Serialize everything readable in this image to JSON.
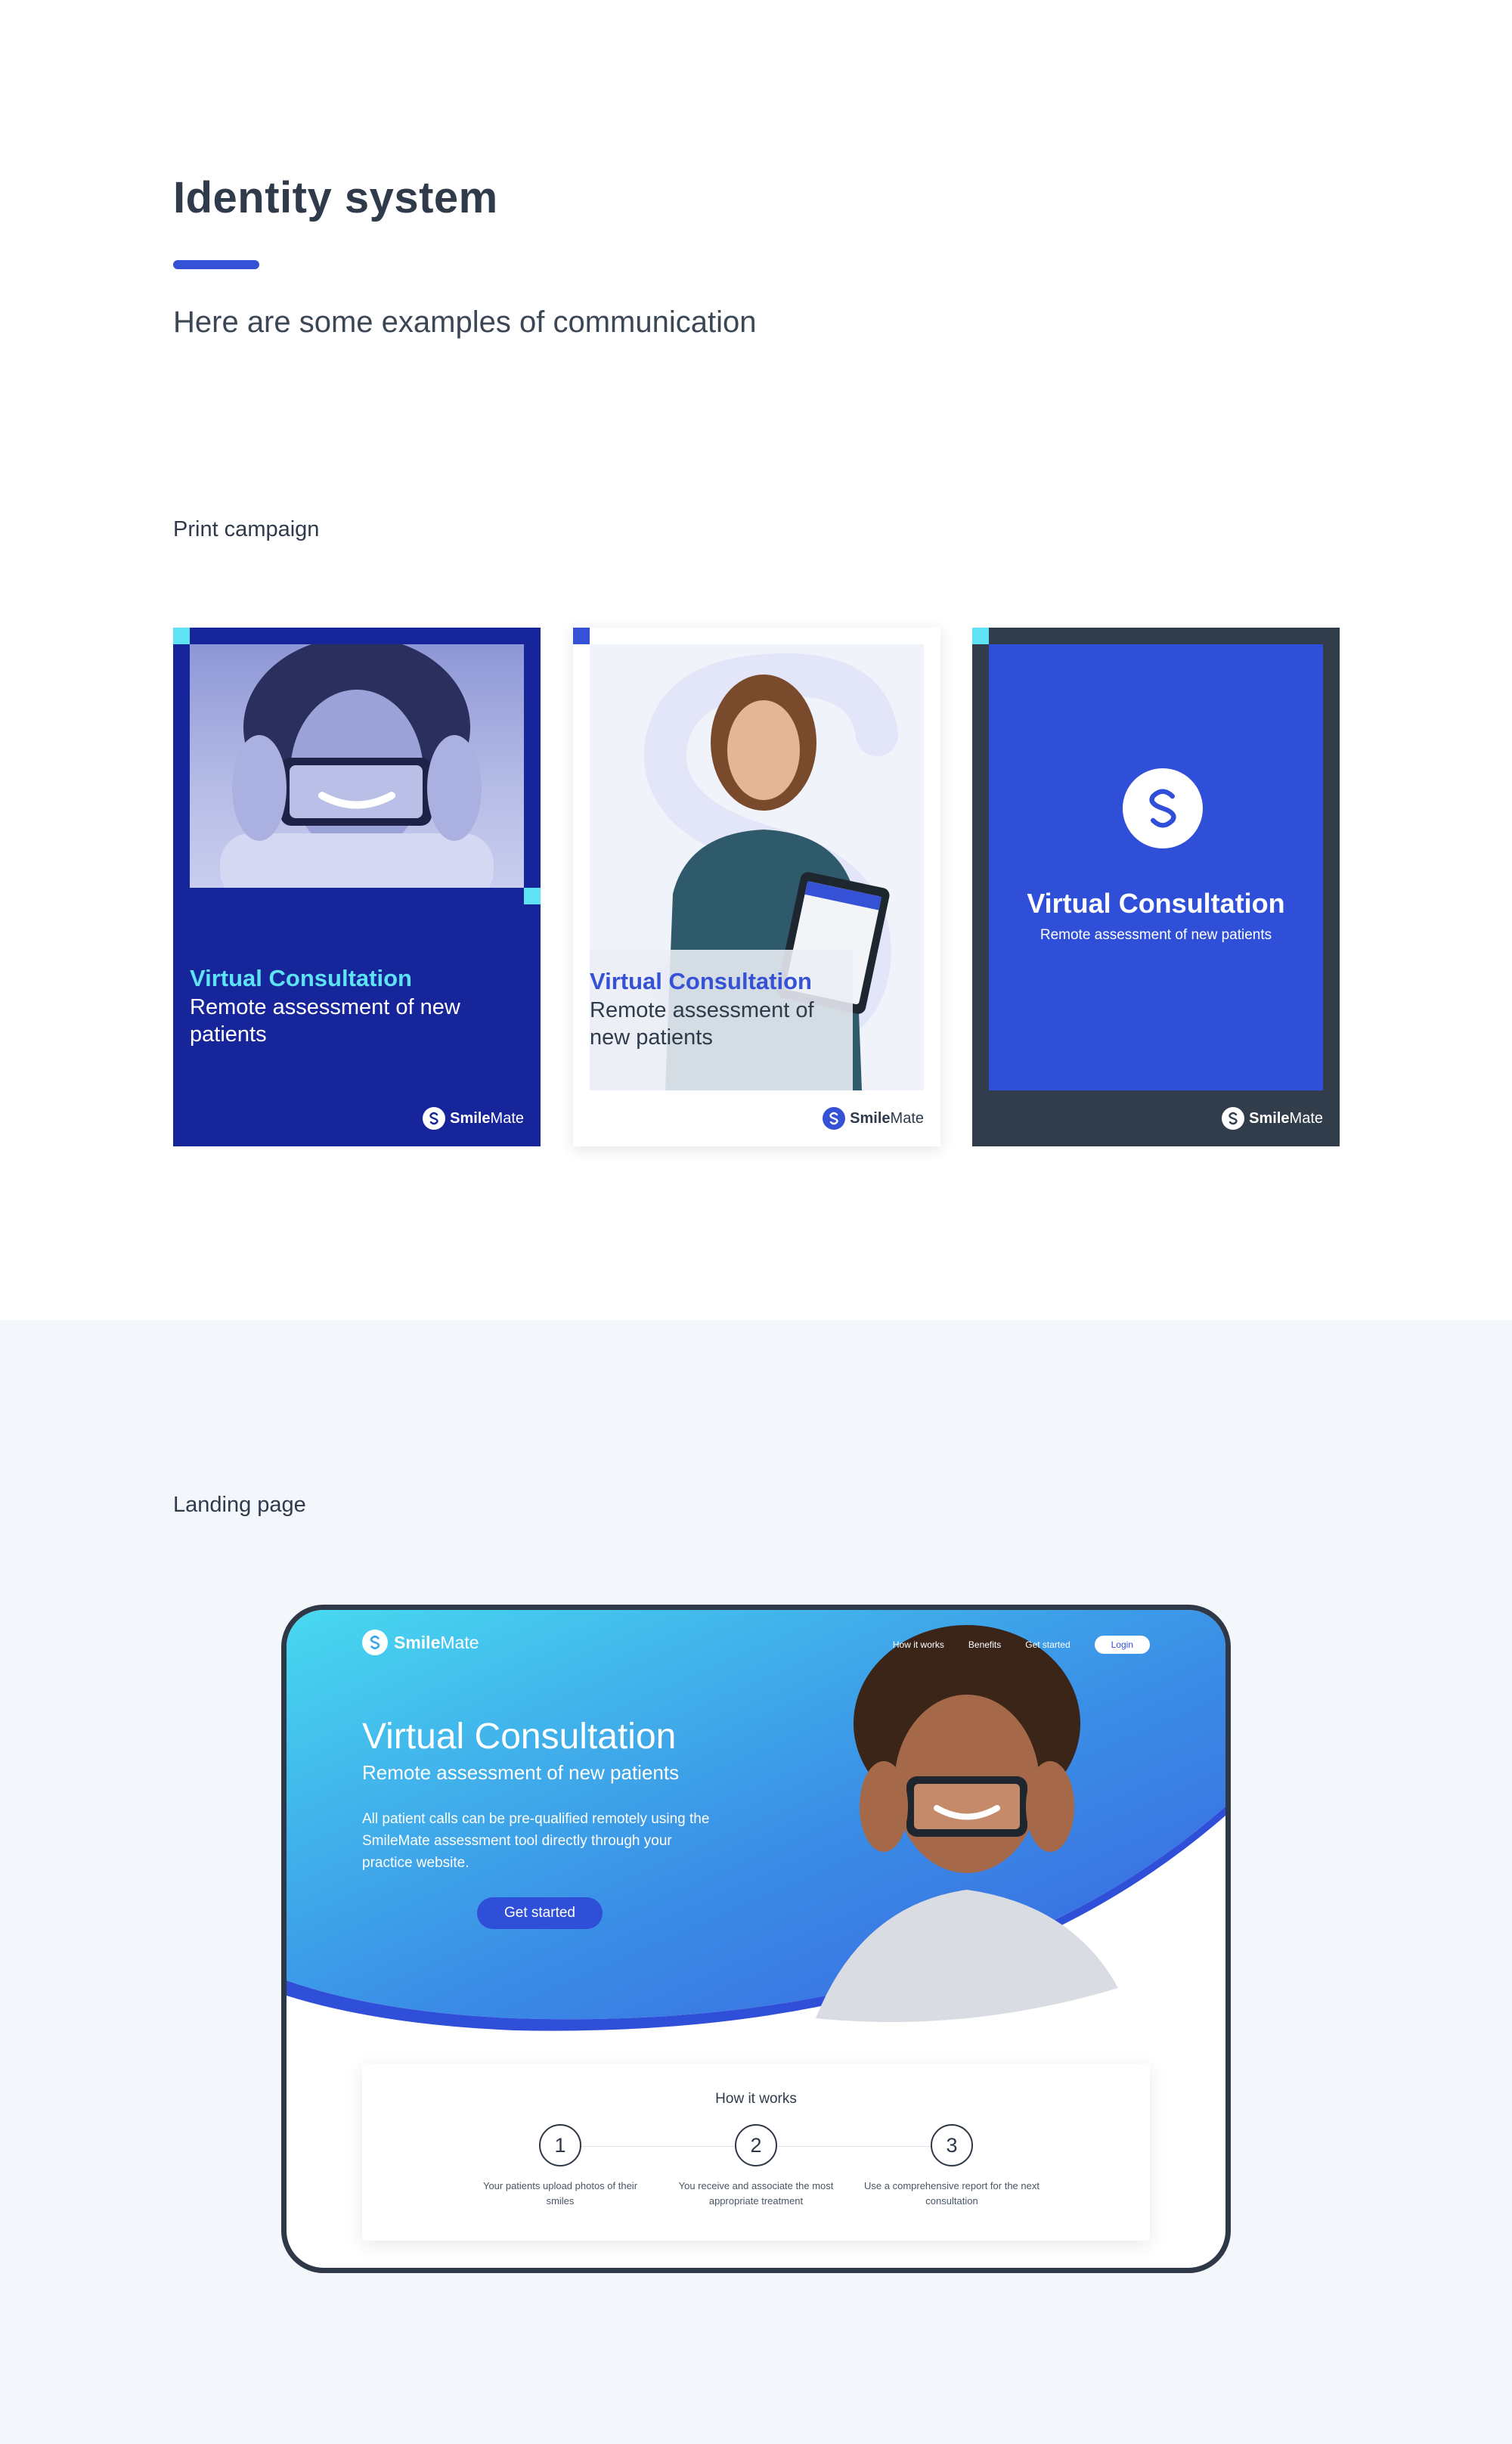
{
  "header": {
    "title": "Identity system",
    "subtitle": "Here are some examples of communication"
  },
  "print_campaign": {
    "label": "Print campaign",
    "brand": {
      "smile": "Smile",
      "mate": "Mate"
    },
    "posters": [
      {
        "title": "Virtual Consultation",
        "subtitle": "Remote assessment of new patients"
      },
      {
        "title": "Virtual Consultation",
        "subtitle": "Remote assessment of new patients"
      },
      {
        "title": "Virtual Consultation",
        "subtitle": "Remote assessment of new patients"
      }
    ]
  },
  "landing_page": {
    "label": "Landing page",
    "brand": {
      "smile": "Smile",
      "mate": "Mate"
    },
    "nav": {
      "how_it_works": "How it works",
      "benefits": "Benefits",
      "get_started": "Get started",
      "login": "Login"
    },
    "hero": {
      "title": "Virtual Consultation",
      "subtitle": "Remote assessment of new patients",
      "body": "All patient calls can be pre-qualified remotely using the SmileMate assessment tool directly through your practice website.",
      "cta": "Get started"
    },
    "how_it_works": {
      "title": "How it works",
      "steps": [
        {
          "number": "1",
          "text": "Your patients upload photos of their smiles"
        },
        {
          "number": "2",
          "text": "You receive and associate the most appropriate treatment"
        },
        {
          "number": "3",
          "text": "Use a comprehensive report for the next consultation"
        }
      ]
    }
  },
  "colors": {
    "primary_blue": "#3552d6",
    "navy": "#17259a",
    "cyan": "#5ee3f4",
    "dark_slate": "#323d4b",
    "section_bg": "#f3f6fb"
  }
}
